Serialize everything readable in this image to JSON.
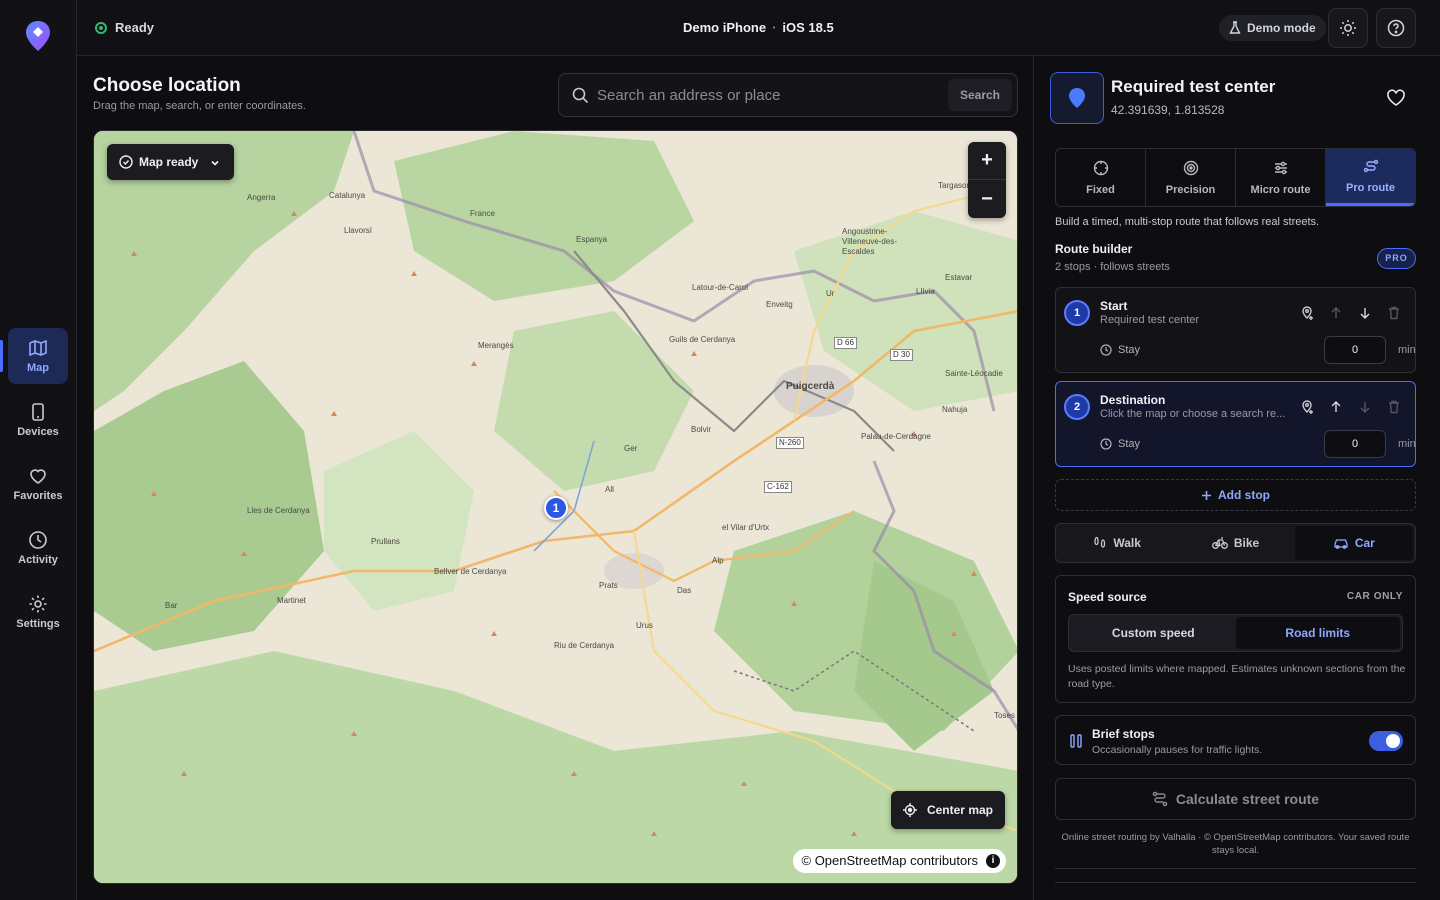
{
  "status": {
    "label": "Ready"
  },
  "device": {
    "name": "Demo iPhone",
    "separator": "·",
    "os": "iOS 18.5"
  },
  "demo_mode": {
    "label": "Demo mode"
  },
  "sidebar": {
    "items": [
      {
        "label": "Map",
        "icon": "map-icon",
        "active": true
      },
      {
        "label": "Devices",
        "icon": "phone-icon"
      },
      {
        "label": "Favorites",
        "icon": "heart-icon"
      },
      {
        "label": "Activity",
        "icon": "clock-icon"
      },
      {
        "label": "Settings",
        "icon": "gear-icon"
      }
    ]
  },
  "header": {
    "title": "Choose location",
    "subtitle": "Drag the map, search, or enter coordinates."
  },
  "search": {
    "placeholder": "Search an address or place",
    "button": "Search"
  },
  "map": {
    "status_chip": "Map ready",
    "zoom_in": "+",
    "zoom_out": "−",
    "center_button": "Center map",
    "attribution": "© OpenStreetMap contributors",
    "marker_label": "1",
    "places": [
      "Angerra",
      "Catalunya",
      "Llavorsí",
      "France",
      "Espanya",
      "Targasonne",
      "Angoustrine-Villeneuve-des-Escaldes",
      "Latour-de-Carol",
      "Enveitg",
      "Ur",
      "Estavar",
      "Llívia",
      "Merangès",
      "Guils de Cerdanya",
      "Puigcerdà",
      "D 66",
      "D 30",
      "Sainte-Léocadie",
      "Nahuja",
      "Palau-de-Cerdagne",
      "Bolvir",
      "N-260",
      "Ger",
      "C-162",
      "All",
      "el Vilar d'Urtx",
      "Lles de Cerdanya",
      "Prullans",
      "Alp",
      "Bellver de Cerdanya",
      "Prats",
      "Das",
      "Martinet",
      "Bar",
      "Urus",
      "Riu de Cerdanya",
      "Toses"
    ]
  },
  "location": {
    "title": "Required test center",
    "coords": "42.391639, 1.813528"
  },
  "modes": [
    {
      "label": "Fixed",
      "icon": "crosshair-icon"
    },
    {
      "label": "Precision",
      "icon": "target-icon"
    },
    {
      "label": "Micro route",
      "icon": "sliders-icon"
    },
    {
      "label": "Pro route",
      "icon": "route-icon",
      "active": true
    }
  ],
  "mode_desc": "Build a timed, multi-stop route that follows real streets.",
  "route_builder": {
    "title": "Route builder",
    "subtitle": "2 stops · follows streets",
    "badge": "PRO",
    "stops": [
      {
        "num": "1",
        "name": "Start",
        "desc": "Required test center",
        "stay_label": "Stay",
        "stay_value": "0",
        "unit": "min"
      },
      {
        "num": "2",
        "name": "Destination",
        "desc": "Click the map or choose a search re...",
        "stay_label": "Stay",
        "stay_value": "0",
        "unit": "min"
      }
    ],
    "add_stop": "Add stop"
  },
  "transport": [
    {
      "label": "Walk",
      "icon": "walk-icon"
    },
    {
      "label": "Bike",
      "icon": "bike-icon"
    },
    {
      "label": "Car",
      "icon": "car-icon",
      "active": true
    }
  ],
  "speed": {
    "title": "Speed source",
    "tag": "CAR ONLY",
    "options": [
      "Custom speed",
      "Road limits"
    ],
    "active": "Road limits",
    "note": "Uses posted limits where mapped. Estimates unknown sections from the road type."
  },
  "brief": {
    "title": "Brief stops",
    "subtitle": "Occasionally pauses for traffic lights.",
    "enabled": true
  },
  "calculate": {
    "label": "Calculate street route"
  },
  "footer": {
    "note": "Online street routing by Valhalla · © OpenStreetMap contributors. Your saved route stays local."
  },
  "colors": {
    "accent": "#4a6cff",
    "background": "#0e0e11",
    "ready": "#2eb872"
  }
}
